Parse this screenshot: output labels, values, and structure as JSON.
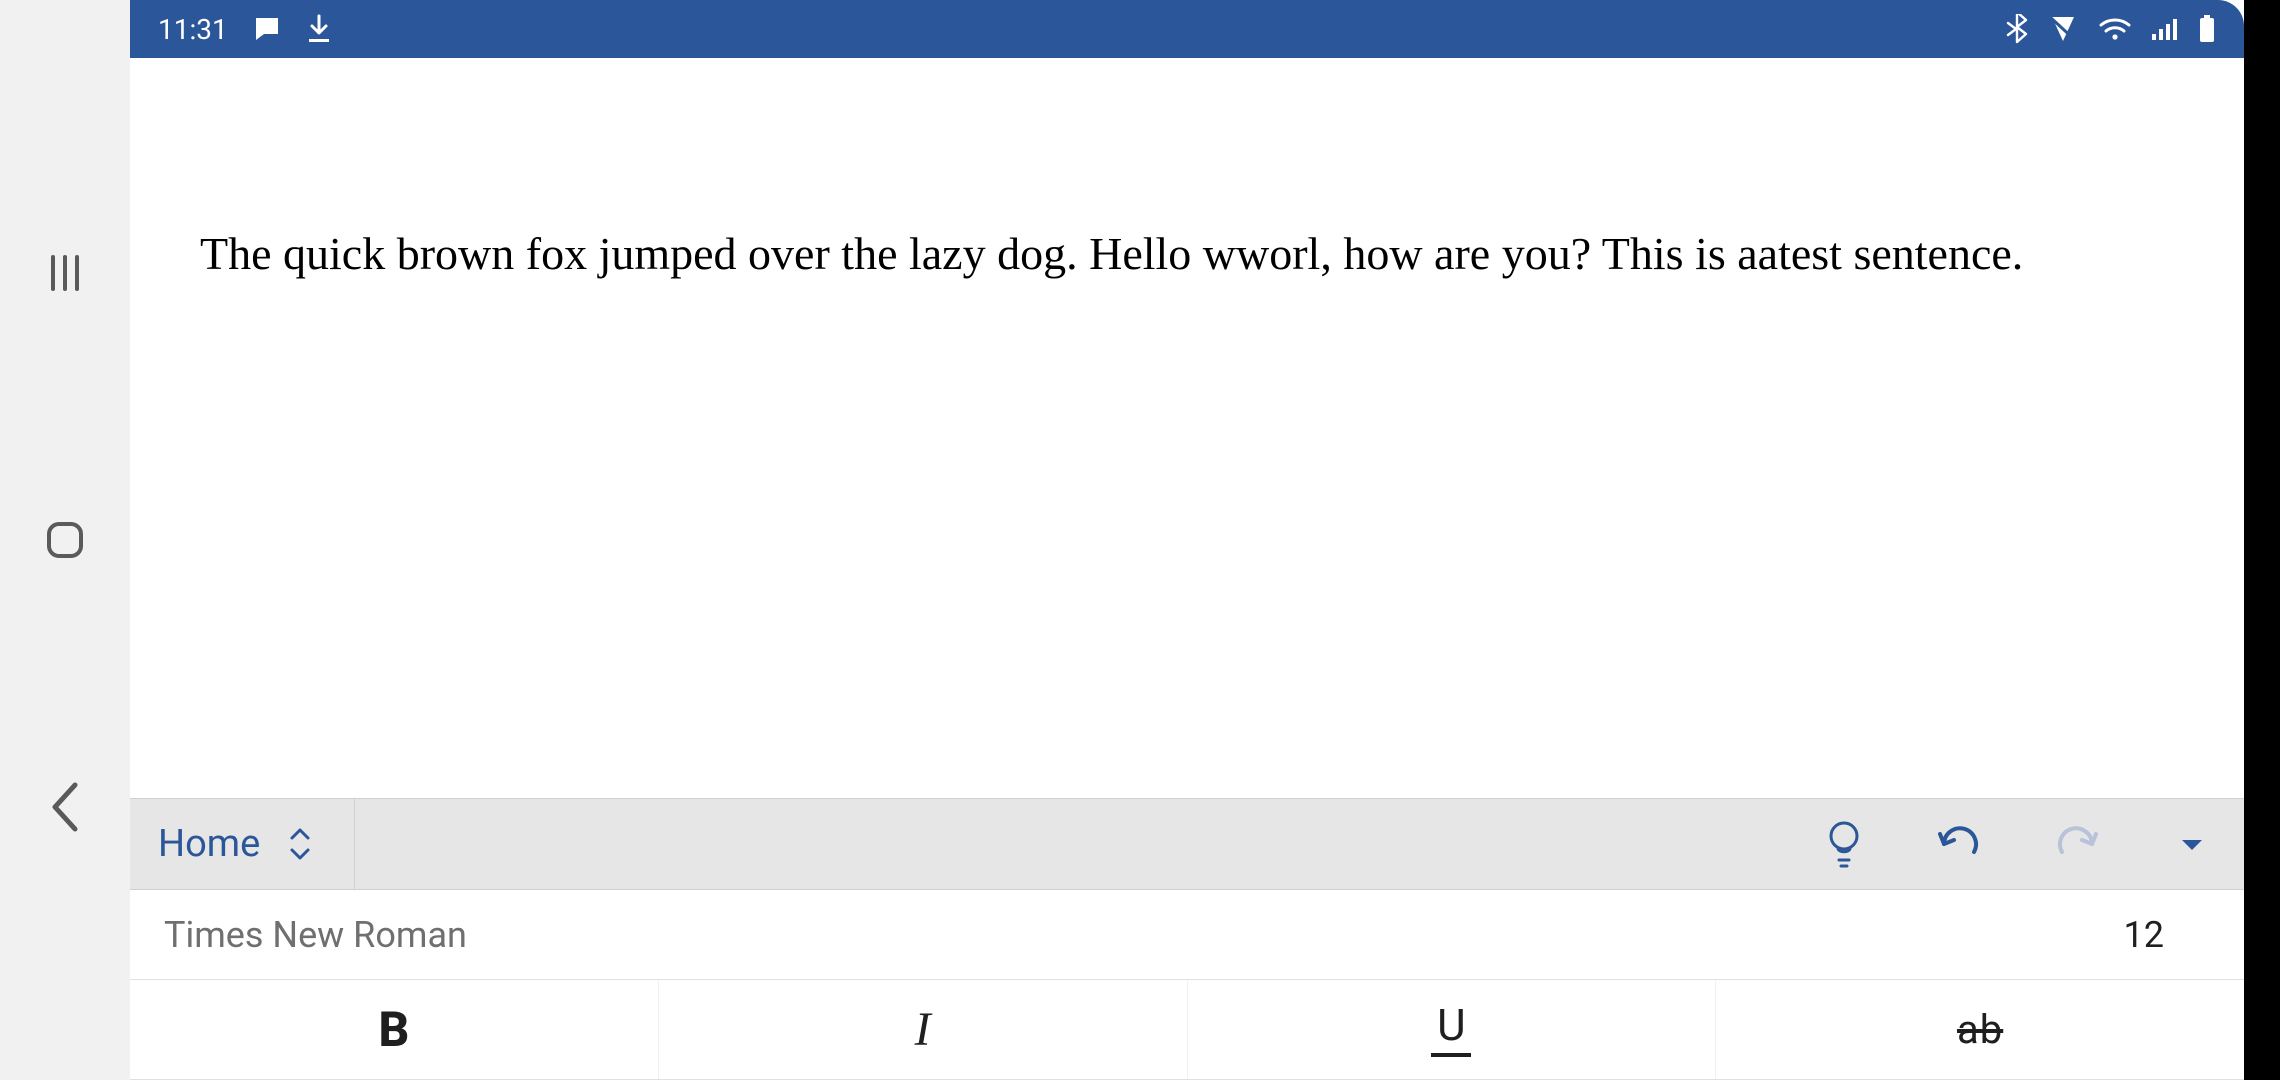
{
  "status": {
    "time": "11:31"
  },
  "document": {
    "text": "The quick brown fox jumped over the lazy dog. Hello wworl, how are you? This is aatest sentence."
  },
  "ribbon": {
    "tab_label": "Home"
  },
  "font": {
    "name": "Times New Roman",
    "size": "12"
  },
  "format": {
    "bold": "B",
    "italic": "I",
    "underline": "U",
    "strike": "ab"
  }
}
